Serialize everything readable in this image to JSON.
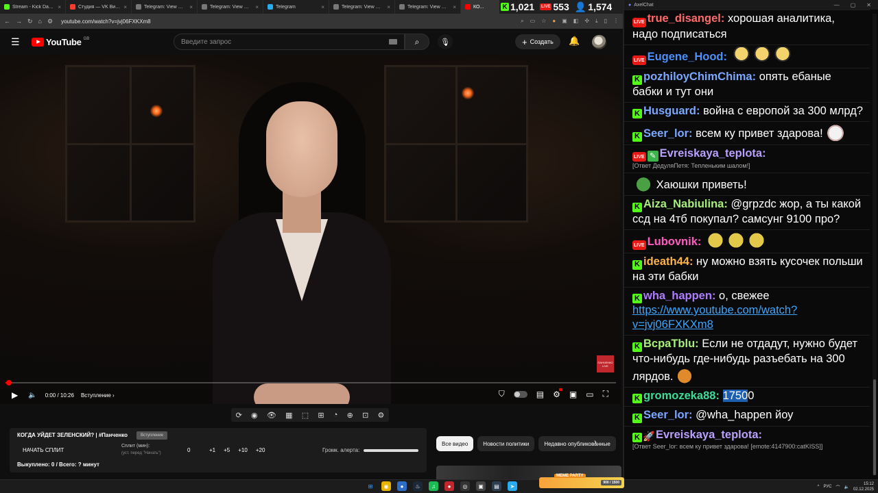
{
  "browser": {
    "tabs": [
      {
        "label": "Stream - Kick Dashbo...",
        "color": "#53fc18"
      },
      {
        "label": "Студия — VK Видео I...",
        "color": "#ff3b30"
      },
      {
        "label": "Telegram: View @unio",
        "color": "#777777"
      },
      {
        "label": "Telegram: View @Hoh...",
        "color": "#777777"
      },
      {
        "label": "Telegram",
        "color": "#2aabee"
      },
      {
        "label": "Telegram: View @truez",
        "color": "#777777"
      },
      {
        "label": "Telegram: View @crim",
        "color": "#777777"
      },
      {
        "label": "КО...",
        "color": "#ff0000"
      }
    ],
    "url": "youtube.com/watch?v=jvj06FXKXm8"
  },
  "viewer_counts": {
    "kick": "1,021",
    "live": "553",
    "total": "1,574"
  },
  "youtube": {
    "logo_text": "YouTube",
    "country": "GB",
    "search_placeholder": "Введите запрос",
    "create_label": "Создать",
    "watermark_text": "ПАНЧЕНКО LIVE",
    "player": {
      "time": "0:00 / 10:26",
      "chapter": "Вступление",
      "progress_percent": 0.5
    },
    "chips": [
      "Все видео",
      "Новости политики",
      "Недавно опубликованные"
    ]
  },
  "split_panel": {
    "title": "КОГДА УЙДЕТ ЗЕЛЕНСКИЙ? | #Панченко",
    "badge": "Вступление",
    "start_label": "НАЧАТЬ СПЛИТ",
    "split_label": "Сплит (мин):",
    "split_hint": "(уст. перед \"Начать\")",
    "zero": "0",
    "increments": [
      "+1",
      "+5",
      "+10",
      "+20"
    ],
    "alert_label": "Громк. алерта:",
    "status": "Выкуплено: 0 / Всего: ? минут"
  },
  "chat": {
    "window_title": "AxelChat",
    "messages": [
      {
        "platform": "live",
        "user": "true_disangel",
        "color": "#ff6b6b",
        "text": "хорошая аналитика, надо подписаться"
      },
      {
        "platform": "live",
        "user": "Eugene_Hood",
        "color": "#4a90ff",
        "text": "",
        "emotes": [
          "duck",
          "duck",
          "duck"
        ]
      },
      {
        "platform": "kick",
        "user": "pozhiloyChimChima",
        "color": "#7aa7ff",
        "text": "опять ебаные бабки и тут они"
      },
      {
        "platform": "kick",
        "user": "Husguard",
        "color": "#7aa7ff",
        "text": "война с европой за 300 млрд?"
      },
      {
        "platform": "kick",
        "user": "Seer_lor",
        "color": "#7aa7ff",
        "text": "всем ку привет здарова!",
        "emotes": [
          "catkiss"
        ]
      },
      {
        "platform": "live",
        "badge": "pen",
        "user": "Evreiskaya_teplota",
        "color": "#b9a0ff",
        "reply": "[Ответ ДедуляПетя: Тепленьким шалом!]",
        "text": ""
      },
      {
        "platform": "pepe",
        "user": "",
        "color": "#ffffff",
        "text": "Хаюшки приветь!"
      },
      {
        "platform": "kick",
        "user": "Aiza_Nabiulina",
        "color": "#a6f07a",
        "text": "@grpzdc жор, а ты какой ссд на 4тб покупал? самсунг 9100 про?"
      },
      {
        "platform": "live",
        "user": "Lubovnik",
        "color": "#ff5cbf",
        "text": "",
        "emotes": [
          "cat",
          "cat",
          "cat"
        ]
      },
      {
        "platform": "kick",
        "user": "ideath44",
        "color": "#ffb347",
        "text": "ну можно взять кусочек польши на эти бабки"
      },
      {
        "platform": "kick",
        "user": "wha_happen",
        "color": "#b07cff",
        "text": "о, свежее",
        "link": "https://www.youtube.com/watch?v=jvj06FXKXm8"
      },
      {
        "platform": "kick",
        "user": "BcpaTblu",
        "color": "#a6f07a",
        "text": "Если не отдадут, нужно будет что-нибудь где-нибудь разъебать на 300 лярдов.",
        "emotes": [
          "fox"
        ]
      },
      {
        "platform": "kick",
        "user": "gromozeka88",
        "color": "#3ddc97",
        "text": "",
        "highlight": "1750",
        "text_after": "0"
      },
      {
        "platform": "kick",
        "user": "Seer_lor",
        "color": "#7aa7ff",
        "text": "@wha_happen йоу"
      },
      {
        "platform": "kick",
        "badge": "rocket",
        "user": "Evreiskaya_teplota",
        "color": "#b9a0ff",
        "reply": "[Ответ Seer_lor: всем ку привет здарова! [emote:4147900:catKISS]]",
        "text": ""
      }
    ]
  },
  "taskbar": {
    "widget_title": "MEME PARTY",
    "widget_value": "900 / 1500",
    "lang": "РУС",
    "time": "15:12",
    "date": "02.12.2025"
  }
}
